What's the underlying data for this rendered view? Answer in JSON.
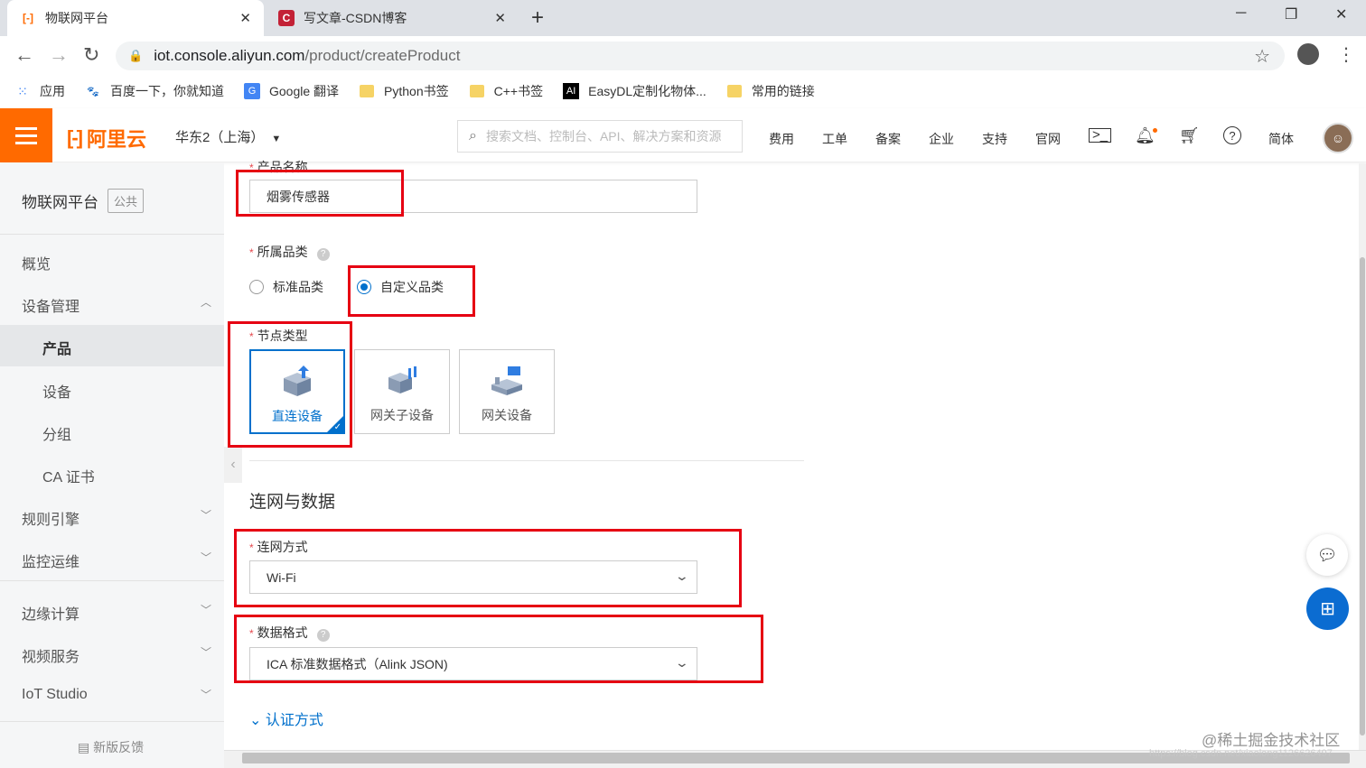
{
  "browser": {
    "tabs": [
      {
        "title": "物联网平台",
        "active": true
      },
      {
        "title": "写文章-CSDN博客",
        "active": false
      }
    ],
    "new_tab": "+",
    "url_host": "iot.console.aliyun.com",
    "url_path": "/product/createProduct",
    "bookmarks": [
      {
        "label": "应用",
        "icon": "apps-grid-icon"
      },
      {
        "label": "百度一下，你就知道",
        "icon": "baidu-icon"
      },
      {
        "label": "Google 翻译",
        "icon": "google-translate-icon"
      },
      {
        "label": "Python书签",
        "icon": "folder-icon"
      },
      {
        "label": "C++书签",
        "icon": "folder-icon"
      },
      {
        "label": "EasyDL定制化物体...",
        "icon": "ai-icon"
      },
      {
        "label": "常用的链接",
        "icon": "folder-icon"
      }
    ]
  },
  "console": {
    "logo": "阿里云",
    "region": "华东2（上海）",
    "search_placeholder": "搜索文档、控制台、API、解决方案和资源",
    "links": [
      "费用",
      "工单",
      "备案",
      "企业",
      "支持",
      "官网"
    ],
    "lang": "简体",
    "brand_color": "#ff6a00"
  },
  "sidebar": {
    "title": "物联网平台",
    "tag": "公共",
    "items": [
      {
        "label": "概览"
      },
      {
        "label": "设备管理"
      },
      {
        "label": "产品"
      },
      {
        "label": "设备"
      },
      {
        "label": "分组"
      },
      {
        "label": "CA 证书"
      },
      {
        "label": "规则引擎"
      },
      {
        "label": "监控运维"
      },
      {
        "label": "边缘计算"
      },
      {
        "label": "视频服务"
      },
      {
        "label": "IoT Studio"
      }
    ],
    "feedback": "新版反馈"
  },
  "form": {
    "product_name_label": "产品名称",
    "product_name_value": "烟雾传感器",
    "category_label": "所属品类",
    "category_options": [
      "标准品类",
      "自定义品类"
    ],
    "category_selected": "自定义品类",
    "node_type_label": "节点类型",
    "node_types": [
      "直连设备",
      "网关子设备",
      "网关设备"
    ],
    "node_type_selected": "直连设备",
    "section_network": "连网与数据",
    "network_label": "连网方式",
    "network_value": "Wi-Fi",
    "data_format_label": "数据格式",
    "data_format_value": "ICA 标准数据格式（Alink JSON)",
    "auth_link": "认证方式",
    "accent_color": "#0070cc",
    "highlight_color": "#e60012"
  },
  "watermark": "@稀土掘金技术社区",
  "watermark_url": "https://blog.csdn.net/xiaolong1126626497"
}
